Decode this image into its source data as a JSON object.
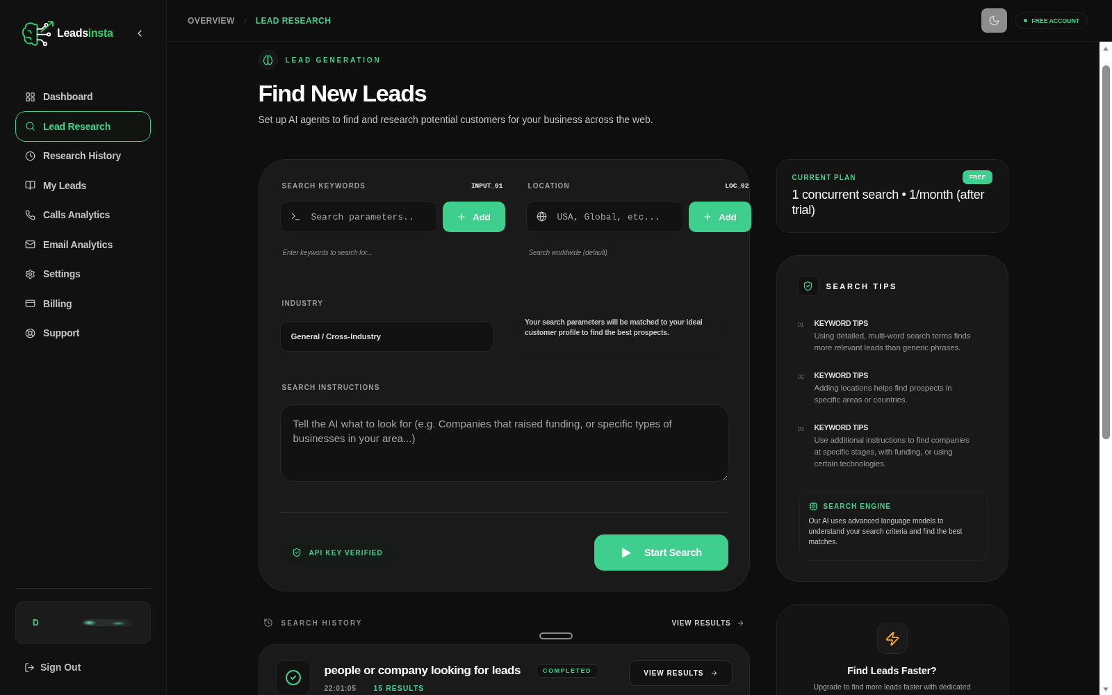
{
  "sidebar": {
    "brand": {
      "name": "Leads",
      "accent": "insta"
    },
    "nav_items": [
      {
        "label": "Dashboard",
        "selected": false
      },
      {
        "label": "Lead Research",
        "selected": true
      },
      {
        "label": "Research History",
        "selected": false
      },
      {
        "label": "My Leads",
        "selected": false
      },
      {
        "label": "Calls Analytics",
        "selected": false
      },
      {
        "label": "Email Analytics",
        "selected": false
      },
      {
        "label": "Settings",
        "selected": false
      },
      {
        "label": "Billing",
        "selected": false
      },
      {
        "label": "Support",
        "selected": false
      }
    ],
    "user": {
      "initial": "D"
    },
    "sign_out": "Sign Out"
  },
  "header": {
    "breadcrumb": [
      {
        "label": "OVERVIEW",
        "selected": false
      },
      {
        "label": "LEAD RESEARCH",
        "selected": true
      }
    ],
    "account_badge": "FREE ACCOUNT"
  },
  "page": {
    "eyebrow": "LEAD GENERATION",
    "title": "Find New Leads",
    "subtitle": "Set up AI agents to find and research potential customers for your business across the web."
  },
  "form": {
    "keywords": {
      "label": "SEARCH KEYWORDS",
      "code": "INPUT_01",
      "placeholder": "Search parameters..",
      "button": "Add",
      "hint": "Enter keywords to search for..."
    },
    "location": {
      "label": "LOCATION",
      "code": "LOC_02",
      "placeholder": "USA, Global, etc...",
      "button": "Add",
      "hint": "Search worldwide (default)"
    },
    "industry": {
      "label": "INDUSTRY",
      "value": "General / Cross-Industry"
    },
    "info_note": "Your search parameters will be matched to your ideal customer profile to find the best prospects.",
    "instructions": {
      "label": "SEARCH INSTRUCTIONS",
      "placeholder": "Tell the AI what to look for (e.g. Companies that raised funding, or specific types of businesses in your area...)"
    },
    "api_status": "API KEY VERIFIED",
    "start_button": "Start Search"
  },
  "plan": {
    "label": "CURRENT PLAN",
    "badge": "FREE",
    "description": "1 concurrent search • 1/month (after trial)"
  },
  "tips": {
    "title": "SEARCH TIPS",
    "items": [
      {
        "number": "01",
        "title": "KEYWORD TIPS",
        "text": "Using detailed, multi-word search terms finds more relevant leads than generic phrases."
      },
      {
        "number": "02",
        "title": "KEYWORD TIPS",
        "text": "Adding locations helps find prospects in specific areas or countries."
      },
      {
        "number": "03",
        "title": "KEYWORD TIPS",
        "text": "Use additional instructions to find companies at specific stages, with funding, or using certain technologies."
      }
    ],
    "engine": {
      "title": "SEARCH ENGINE",
      "text": "Our AI uses advanced language models to understand your search criteria and find the best matches."
    }
  },
  "history": {
    "title": "SEARCH HISTORY",
    "link": "VIEW RESULTS",
    "items": [
      {
        "query": "people or company looking for leads",
        "status": "COMPLETED",
        "time": "22:01:05",
        "results": "15 RESULTS",
        "button": "VIEW RESULTS"
      }
    ]
  },
  "upgrade": {
    "title": "Find Leads Faster?",
    "text": "Upgrade to find more leads faster with dedicated"
  }
}
